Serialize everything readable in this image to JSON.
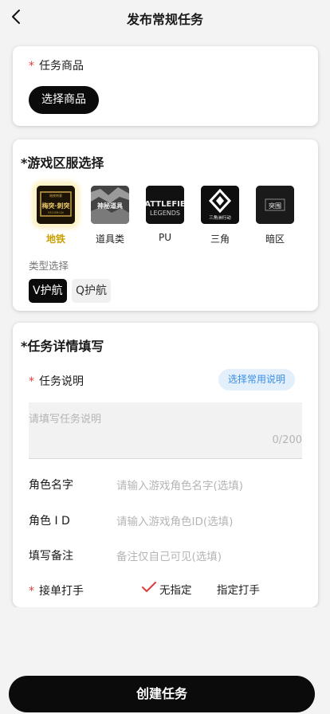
{
  "header": {
    "title": "发布常规任务"
  },
  "product": {
    "label": "任务商品",
    "required": "*",
    "button": "选择商品"
  },
  "server": {
    "title": "*游戏区服选择",
    "items": [
      {
        "label": "地铁",
        "icon": "metro-game-icon",
        "selected": true
      },
      {
        "label": "道具类",
        "icon": "props-game-icon",
        "selected": false
      },
      {
        "label": "PU",
        "icon": "pubg-game-icon",
        "selected": false
      },
      {
        "label": "三角",
        "icon": "delta-game-icon",
        "selected": false
      },
      {
        "label": "暗区",
        "icon": "dark-zone-game-icon",
        "selected": false
      }
    ],
    "icon_texts": {
      "metro_top": "暗夜刺客",
      "metro_main": "梅突·刺突",
      "metro_sub": "EF.COM.CN",
      "props": "神秘道具",
      "pu_top": "ATTLEFIE",
      "pu_bottom": "LEGENDS",
      "delta": "三角洲行动",
      "dark": "突围"
    },
    "type_label": "类型选择",
    "types": [
      {
        "label": "V护航",
        "selected": true
      },
      {
        "label": "Q护航",
        "selected": false
      }
    ]
  },
  "details": {
    "title": "*任务详情填写",
    "required": "*",
    "desc_label": "任务说明",
    "quick_button": "选择常用说明",
    "desc_placeholder": "请填写任务说明",
    "desc_count": "0/200",
    "role_name_label": "角色名字",
    "role_name_placeholder": "请输入游戏角色名字(选填)",
    "role_id_label": "角色 I D",
    "role_id_placeholder": "请输入游戏角色ID(选填)",
    "note_label": "填写备注",
    "note_placeholder": "备注仅自己可见(选填)",
    "player_label": "接单打手",
    "player_options": [
      "无指定",
      "指定打手"
    ]
  },
  "footer": {
    "create_button": "创建任务"
  },
  "colors": {
    "accent": "#0b0b0b",
    "required": "#e23b3b",
    "link": "#3a8ee6",
    "selected_gold": "#c9a000"
  }
}
